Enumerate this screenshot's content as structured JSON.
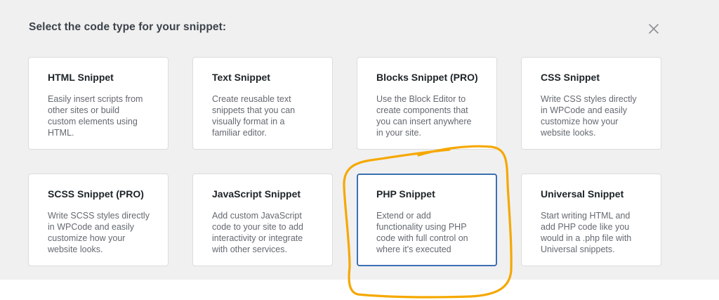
{
  "modal": {
    "title": "Select the code type for your snippet:",
    "close_icon": "close-icon"
  },
  "cards": [
    {
      "title": "HTML Snippet",
      "description": "Easily insert scripts from other sites or build custom elements using HTML."
    },
    {
      "title": "Text Snippet",
      "description": "Create reusable text snippets that you can visually format in a familiar editor."
    },
    {
      "title": "Blocks Snippet (PRO)",
      "description": "Use the Block Editor to create components that you can insert anywhere in your site."
    },
    {
      "title": "CSS Snippet",
      "description": "Write CSS styles directly in WPCode and easily customize how your website looks."
    },
    {
      "title": "SCSS Snippet (PRO)",
      "description": "Write SCSS styles directly in WPCode and easily customize how your website looks."
    },
    {
      "title": "JavaScript Snippet",
      "description": "Add custom JavaScript code to your site to add interactivity or integrate with other services."
    },
    {
      "title": "PHP Snippet",
      "description": "Extend or add functionality using PHP code with full control on where it's executed"
    },
    {
      "title": "Universal Snippet",
      "description": "Start writing HTML and add PHP code like you would in a .php file with Universal snippets."
    }
  ],
  "selected_card": "PHP Snippet",
  "colors": {
    "highlight": "#f5a800",
    "selected_border": "#3b6fb3",
    "modal_background": "#f0f0f1"
  }
}
